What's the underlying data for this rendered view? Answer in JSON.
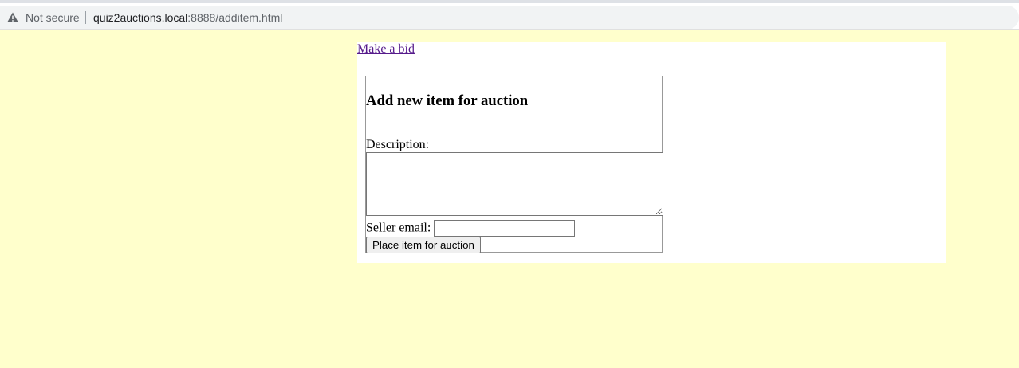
{
  "browser": {
    "security_label": "Not secure",
    "url_host": "quiz2auctions.local",
    "url_rest": ":8888/additem.html",
    "warning_icon": "warning-triangle-icon"
  },
  "nav": {
    "link_label": "Make a bid"
  },
  "form": {
    "title": "Add new item for auction",
    "description_label": "Description:",
    "description_value": "",
    "email_label": "Seller email:",
    "email_value": "",
    "submit_label": "Place item for auction"
  },
  "colors": {
    "page_background": "#ffffcc",
    "content_background": "#ffffff",
    "visited_link": "#551a8b"
  }
}
